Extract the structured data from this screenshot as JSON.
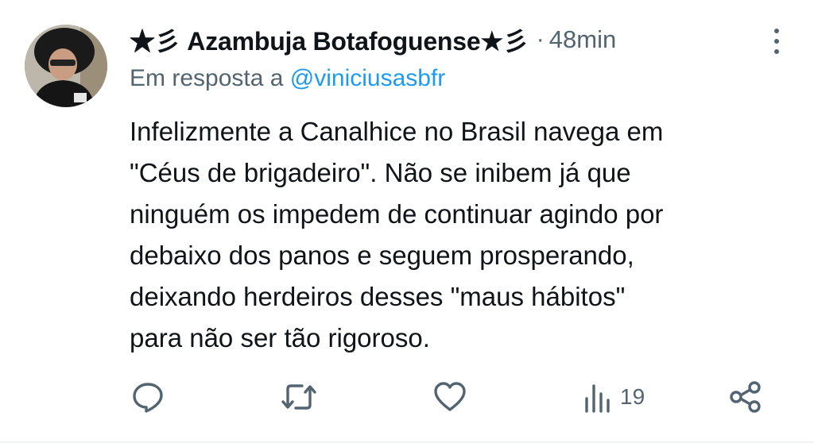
{
  "tweet": {
    "display_name": "★彡 Azambuja Botafoguense★彡",
    "separator": "·",
    "time": "48min",
    "reply_prefix": "Em resposta a ",
    "reply_handle": "@viniciusasbfr",
    "text": "Infelizmente a Canalhice no Brasil navega em\n\"Céus de brigadeiro\". Não se inibem já que\nninguém os impedem de continuar agindo por\ndebaixo dos panos e seguem prosperando,\ndeixando herdeiros desses \"maus hábitos\"\npara não ser tão rigoroso."
  },
  "actions": {
    "views_count": "19"
  },
  "icons": {
    "reply": "speech-bubble-icon",
    "retweet": "retweet-arrows-icon",
    "like": "heart-icon",
    "views": "bar-chart-icon",
    "share": "share-nodes-icon",
    "more": "vertical-dots-icon"
  },
  "colors": {
    "primary_text": "#0f1419",
    "secondary_text": "#536471",
    "link": "#1d9bf0"
  }
}
